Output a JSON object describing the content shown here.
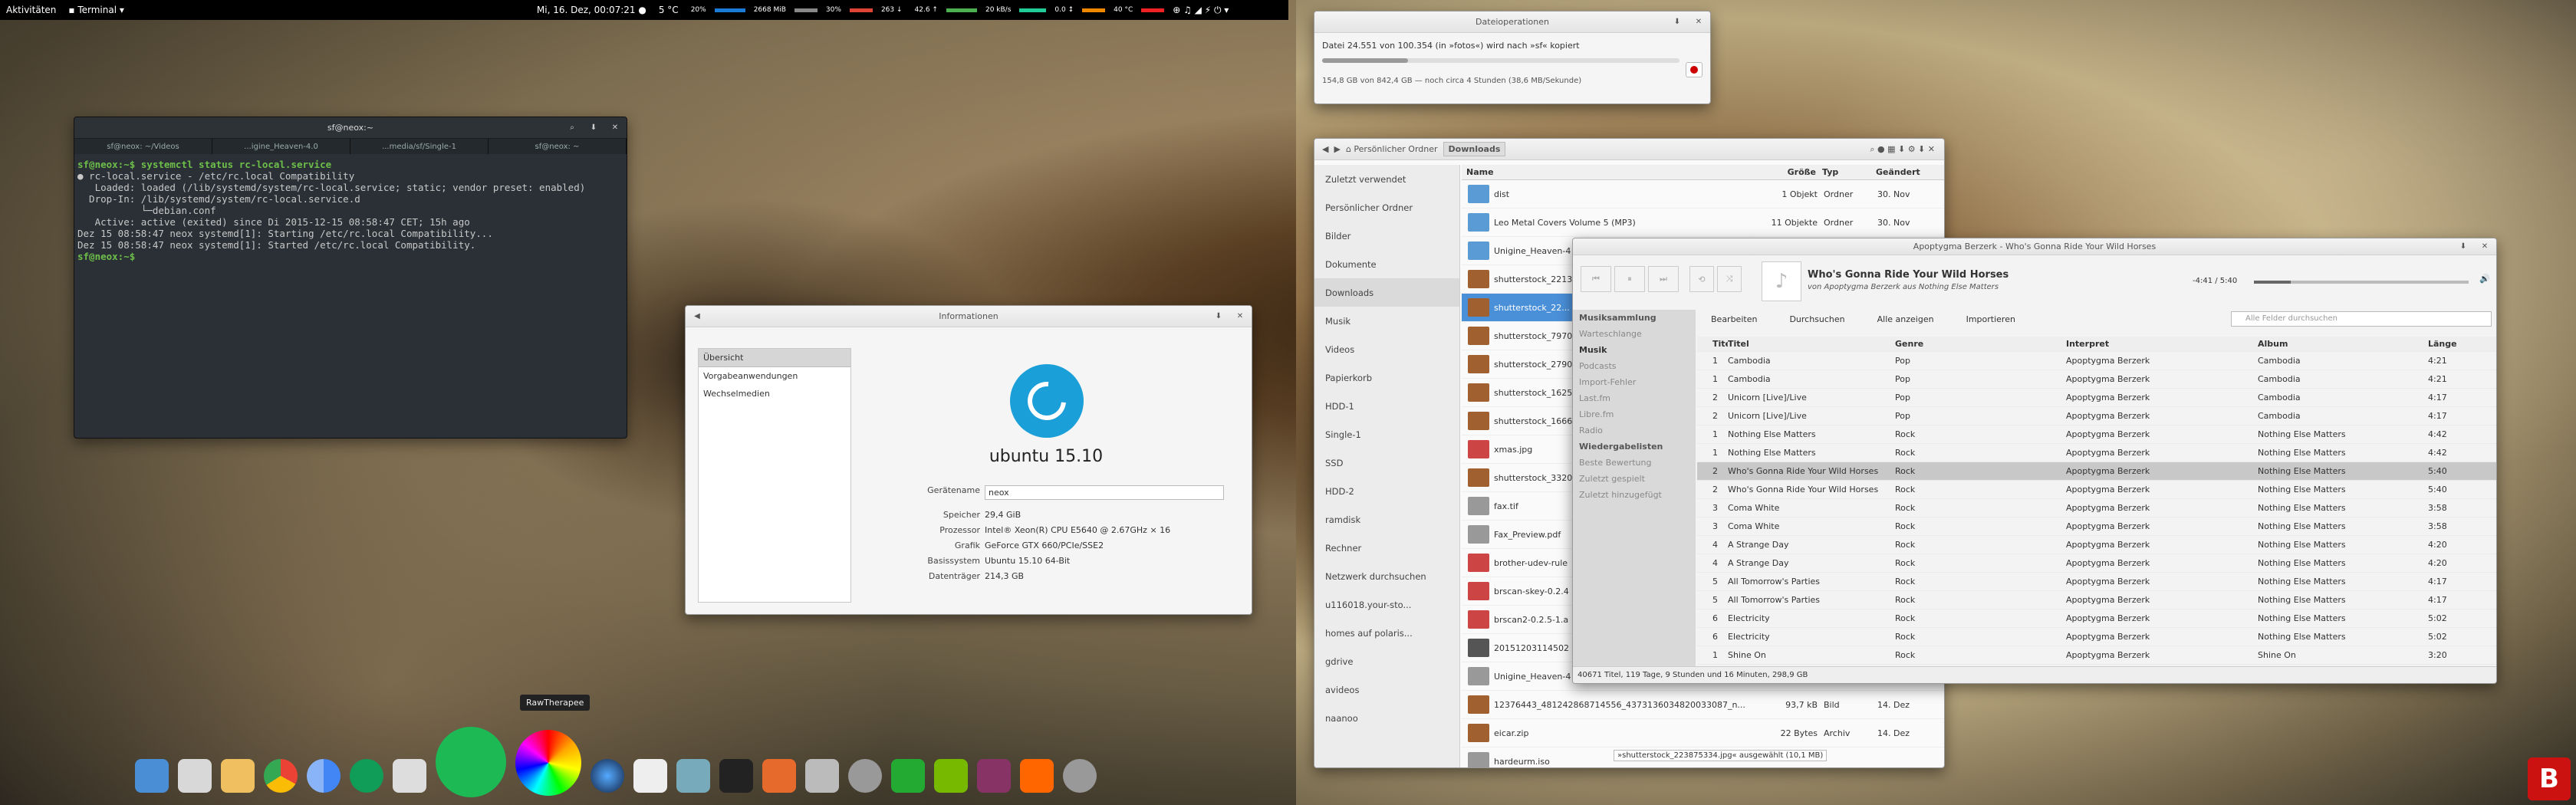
{
  "topbar": {
    "activities": "Aktivitäten",
    "app": "Terminal",
    "clock": "Mi, 16. Dez, 00:07:21 ●",
    "weather": "5 °C",
    "cpu": "20%",
    "mem": "2668 MiB",
    "net": "30%",
    "down": "263 ↓",
    "up": "42.6 ↑",
    "disk_r": "20 kB/s",
    "disk_w": "0.0 ↕",
    "temp": "40 °C"
  },
  "terminal": {
    "title": "sf@neox:~",
    "tabs": [
      "sf@neox: ~/Videos",
      "...igine_Heaven-4.0",
      "...media/sf/Single-1",
      "sf@neox: ~"
    ],
    "lines": [
      "sf@neox:~$ systemctl status rc-local.service",
      "● rc-local.service - /etc/rc.local Compatibility",
      "   Loaded: loaded (/lib/systemd/system/rc-local.service; static; vendor preset: enabled)",
      "  Drop-In: /lib/systemd/system/rc-local.service.d",
      "           └─debian.conf",
      "   Active: active (exited) since Di 2015-12-15 08:58:47 CET; 15h ago",
      "",
      "Dez 15 08:58:47 neox systemd[1]: Starting /etc/rc.local Compatibility...",
      "Dez 15 08:58:47 neox systemd[1]: Started /etc/rc.local Compatibility.",
      "sf@neox:~$ "
    ]
  },
  "info": {
    "title": "Informationen",
    "side": [
      "Übersicht",
      "Vorgabeanwendungen",
      "Wechselmedien"
    ],
    "os": "ubuntu 15.10",
    "rows": [
      {
        "k": "Gerätename",
        "v": "neox"
      },
      {
        "k": "Speicher",
        "v": "29,4 GiB"
      },
      {
        "k": "Prozessor",
        "v": "Intel® Xeon(R) CPU E5640 @ 2.67GHz × 16"
      },
      {
        "k": "Grafik",
        "v": "GeForce GTX 660/PCIe/SSE2"
      },
      {
        "k": "Basissystem",
        "v": "Ubuntu 15.10 64-Bit"
      },
      {
        "k": "Datenträger",
        "v": "214,3 GB"
      }
    ]
  },
  "tooltip": "RawTherapee",
  "progress": {
    "title": "Dateioperationen",
    "line1": "Datei 24.551 von 100.354 (in »fotos«) wird nach »sf« kopiert",
    "line2": "154,8 GB von 842,4 GB — noch circa 4 Stunden (38,6 MB/Sekunde)",
    "fraction": 0.24
  },
  "files": {
    "crumbs": [
      "Persönlicher Ordner",
      "Downloads"
    ],
    "side": [
      "Zuletzt verwendet",
      "Persönlicher Ordner",
      "Bilder",
      "Dokumente",
      "Downloads",
      "Musik",
      "Videos",
      "Papierkorb",
      "HDD-1",
      "Single-1",
      "SSD",
      "HDD-2",
      "ramdisk",
      "Rechner",
      "Netzwerk durchsuchen",
      "u116018.your-sto...",
      "homes auf polaris...",
      "gdrive",
      "avideos",
      "naanoo"
    ],
    "cols": [
      "Name",
      "Größe",
      "Typ",
      "Geändert"
    ],
    "rows": [
      {
        "n": "dist",
        "s": "1 Objekt",
        "t": "Ordner",
        "d": "30. Nov"
      },
      {
        "n": "Leo Metal Covers Volume 5 (MP3)",
        "s": "11 Objekte",
        "t": "Ordner",
        "d": "30. Nov"
      },
      {
        "n": "Unigine_Heaven-4",
        "s": "",
        "t": "",
        "d": ""
      },
      {
        "n": "shutterstock_2213",
        "s": "",
        "t": "",
        "d": ""
      },
      {
        "n": "shutterstock_22...",
        "s": "",
        "t": "",
        "d": ""
      },
      {
        "n": "shutterstock_7970",
        "s": "",
        "t": "",
        "d": ""
      },
      {
        "n": "shutterstock_2790",
        "s": "",
        "t": "",
        "d": ""
      },
      {
        "n": "shutterstock_1625",
        "s": "",
        "t": "",
        "d": ""
      },
      {
        "n": "shutterstock_1666",
        "s": "",
        "t": "",
        "d": ""
      },
      {
        "n": "xmas.jpg",
        "s": "",
        "t": "",
        "d": ""
      },
      {
        "n": "shutterstock_3320",
        "s": "",
        "t": "",
        "d": ""
      },
      {
        "n": "fax.tif",
        "s": "",
        "t": "",
        "d": ""
      },
      {
        "n": "Fax_Preview.pdf",
        "s": "",
        "t": "",
        "d": ""
      },
      {
        "n": "brother-udev-rule",
        "s": "",
        "t": "",
        "d": ""
      },
      {
        "n": "brscan-skey-0.2.4",
        "s": "",
        "t": "",
        "d": ""
      },
      {
        "n": "brscan2-0.2.5-1.a",
        "s": "",
        "t": "",
        "d": ""
      },
      {
        "n": "20151203114502",
        "s": "",
        "t": "",
        "d": ""
      },
      {
        "n": "Unigine_Heaven-4",
        "s": "",
        "t": "",
        "d": ""
      },
      {
        "n": "12376443_481242868714556_4373136034820033087_n...",
        "s": "93,7 kB",
        "t": "Bild",
        "d": "14. Dez"
      },
      {
        "n": "eicar.zip",
        "s": "22 Bytes",
        "t": "Archiv",
        "d": "14. Dez"
      },
      {
        "n": "hardeurm.iso",
        "s": "",
        "t": "",
        "d": ""
      }
    ],
    "status": "»shutterstock_223875334.jpg« ausgewählt (10,1 MB)"
  },
  "music": {
    "title": "Apoptygma Berzerk - Who's Gonna Ride Your Wild Horses",
    "song": "Who's Gonna Ride Your Wild Horses",
    "by": "von Apoptygma Berzerk aus Nothing Else Matters",
    "time": "-4:41 / 5:40",
    "position": 0.17,
    "menu": [
      "Bearbeiten",
      "Durchsuchen",
      "Alle anzeigen",
      "Importieren"
    ],
    "search": "Alle Felder durchsuchen",
    "side": [
      "Musiksammlung",
      "Warteschlange",
      "Musik",
      "Podcasts",
      "Import-Fehler",
      "Last.fm",
      "Libre.fm",
      "Radio",
      "Wiedergabelisten",
      "Beste Bewertung",
      "Zuletzt gespielt",
      "Zuletzt hinzugefügt"
    ],
    "cols": [
      "Titel",
      "Titel",
      "Genre",
      "Interpret",
      "Album",
      "Länge"
    ],
    "rows": [
      [
        "1",
        "Cambodia",
        "Pop",
        "Apoptygma Berzerk",
        "Cambodia",
        "4:21"
      ],
      [
        "1",
        "Cambodia",
        "Pop",
        "Apoptygma Berzerk",
        "Cambodia",
        "4:21"
      ],
      [
        "2",
        "Unicorn [Live]/Live",
        "Pop",
        "Apoptygma Berzerk",
        "Cambodia",
        "4:17"
      ],
      [
        "2",
        "Unicorn [Live]/Live",
        "Pop",
        "Apoptygma Berzerk",
        "Cambodia",
        "4:17"
      ],
      [
        "1",
        "Nothing Else Matters",
        "Rock",
        "Apoptygma Berzerk",
        "Nothing Else Matters",
        "4:42"
      ],
      [
        "1",
        "Nothing Else Matters",
        "Rock",
        "Apoptygma Berzerk",
        "Nothing Else Matters",
        "4:42"
      ],
      [
        "2",
        "Who's Gonna Ride Your Wild Horses",
        "Rock",
        "Apoptygma Berzerk",
        "Nothing Else Matters",
        "5:40"
      ],
      [
        "2",
        "Who's Gonna Ride Your Wild Horses",
        "Rock",
        "Apoptygma Berzerk",
        "Nothing Else Matters",
        "5:40"
      ],
      [
        "3",
        "Coma White",
        "Rock",
        "Apoptygma Berzerk",
        "Nothing Else Matters",
        "3:58"
      ],
      [
        "3",
        "Coma White",
        "Rock",
        "Apoptygma Berzerk",
        "Nothing Else Matters",
        "3:58"
      ],
      [
        "4",
        "A Strange Day",
        "Rock",
        "Apoptygma Berzerk",
        "Nothing Else Matters",
        "4:20"
      ],
      [
        "4",
        "A Strange Day",
        "Rock",
        "Apoptygma Berzerk",
        "Nothing Else Matters",
        "4:20"
      ],
      [
        "5",
        "All Tomorrow's Parties",
        "Rock",
        "Apoptygma Berzerk",
        "Nothing Else Matters",
        "4:17"
      ],
      [
        "5",
        "All Tomorrow's Parties",
        "Rock",
        "Apoptygma Berzerk",
        "Nothing Else Matters",
        "4:17"
      ],
      [
        "6",
        "Electricity",
        "Rock",
        "Apoptygma Berzerk",
        "Nothing Else Matters",
        "5:02"
      ],
      [
        "6",
        "Electricity",
        "Rock",
        "Apoptygma Berzerk",
        "Nothing Else Matters",
        "5:02"
      ],
      [
        "1",
        "Shine On",
        "Rock",
        "Apoptygma Berzerk",
        "Shine On",
        "3:20"
      ]
    ],
    "status": "40671 Titel, 119 Tage, 9 Stunden und 16 Minuten, 298,9 GB"
  },
  "colors": {
    "accent": "#1a9fd8",
    "spotify": "#1db954",
    "panel": "#000000",
    "selection": "#4a90d9"
  }
}
